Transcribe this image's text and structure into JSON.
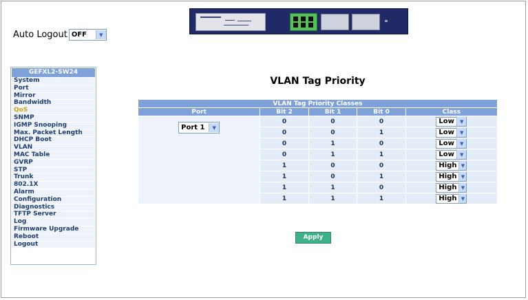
{
  "auto_logout": {
    "label": "Auto Logout",
    "value": "OFF"
  },
  "sidebar": {
    "title": "GEFXL2-SW24",
    "items": [
      {
        "label": "System"
      },
      {
        "label": "Port"
      },
      {
        "label": "Mirror"
      },
      {
        "label": "Bandwidth"
      },
      {
        "label": "QoS",
        "active": true
      },
      {
        "label": "SNMP"
      },
      {
        "label": "IGMP Snooping"
      },
      {
        "label": "Max. Packet Length"
      },
      {
        "label": "DHCP Boot"
      },
      {
        "label": "VLAN"
      },
      {
        "label": "MAC Table"
      },
      {
        "label": "GVRP"
      },
      {
        "label": "STP"
      },
      {
        "label": "Trunk"
      },
      {
        "label": "802.1X"
      },
      {
        "label": "Alarm"
      },
      {
        "label": "Configuration"
      },
      {
        "label": "Diagnostics"
      },
      {
        "label": "TFTP Server"
      },
      {
        "label": "Log"
      },
      {
        "label": "Firmware Upgrade"
      },
      {
        "label": "Reboot"
      },
      {
        "label": "Logout"
      }
    ]
  },
  "main": {
    "title": "VLAN Tag Priority",
    "table": {
      "title": "VLAN Tag Priority Classes",
      "headers": [
        "Port",
        "Bit 2",
        "Bit 1",
        "Bit 0",
        "Class"
      ],
      "port_value": "Port 1",
      "rows": [
        {
          "bit2": "0",
          "bit1": "0",
          "bit0": "0",
          "class": "Low"
        },
        {
          "bit2": "0",
          "bit1": "0",
          "bit0": "1",
          "class": "Low"
        },
        {
          "bit2": "0",
          "bit1": "1",
          "bit0": "0",
          "class": "Low"
        },
        {
          "bit2": "0",
          "bit1": "1",
          "bit0": "1",
          "class": "Low"
        },
        {
          "bit2": "1",
          "bit1": "0",
          "bit0": "0",
          "class": "High"
        },
        {
          "bit2": "1",
          "bit1": "0",
          "bit0": "1",
          "class": "High"
        },
        {
          "bit2": "1",
          "bit1": "1",
          "bit0": "0",
          "class": "High"
        },
        {
          "bit2": "1",
          "bit1": "1",
          "bit0": "1",
          "class": "High"
        }
      ]
    },
    "apply_label": "Apply"
  },
  "colors": {
    "header_blue": "#7ea1d9",
    "apply_green": "#3fb28a",
    "active_item": "#c9a818"
  }
}
